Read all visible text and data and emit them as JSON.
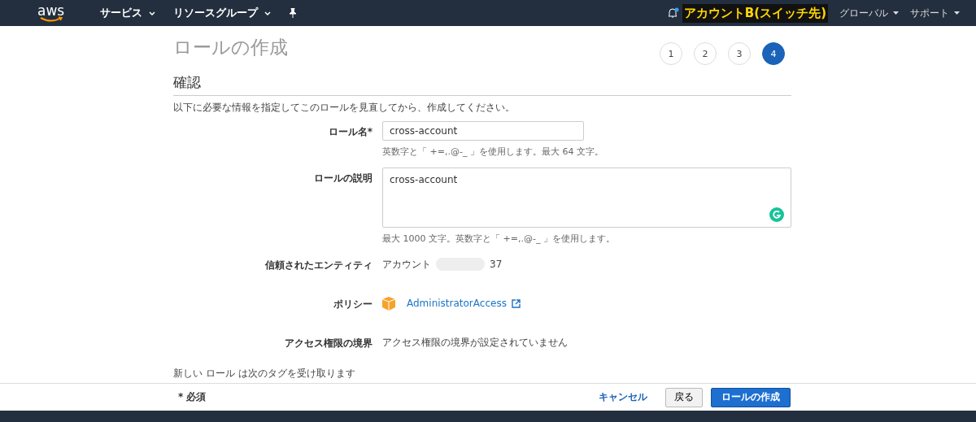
{
  "nav": {
    "logo": "aws",
    "menus": [
      {
        "label": "サービス"
      },
      {
        "label": "リソースグループ"
      }
    ],
    "account": "アカウントB(スイッチ先)",
    "region": "グローバル",
    "support": "サポート"
  },
  "page": {
    "title": "ロールの作成",
    "steps": [
      {
        "label": "1",
        "selected": false
      },
      {
        "label": "2",
        "selected": false
      },
      {
        "label": "3",
        "selected": false
      },
      {
        "label": "4",
        "selected": true
      }
    ],
    "section": "確認",
    "intro": "以下に必要な情報を指定してこのロールを見直してから、作成してください。",
    "role_name": {
      "label": "ロール名*",
      "value": "cross-account",
      "hint": "英数字と「 +=,.@-_ 」を使用します。最大 64 文字。"
    },
    "description": {
      "label": "ロールの説明",
      "value": "cross-account",
      "hint": "最大 1000 文字。英数字と「 +=,.@-_ 」を使用します。"
    },
    "entity": {
      "label": "信頼されたエンティティ",
      "prefix": "アカウント",
      "suffix": "37"
    },
    "policy": {
      "label": "ポリシー",
      "link": "AdministratorAccess"
    },
    "boundary": {
      "label": "アクセス権限の境界",
      "value": "アクセス権限の境界が設定されていません"
    },
    "tags_note": "新しい ロール は次のタグを受け取ります"
  },
  "footer": {
    "required": "* 必須",
    "cancel": "キャンセル",
    "back": "戻る",
    "create": "ロールの作成"
  }
}
